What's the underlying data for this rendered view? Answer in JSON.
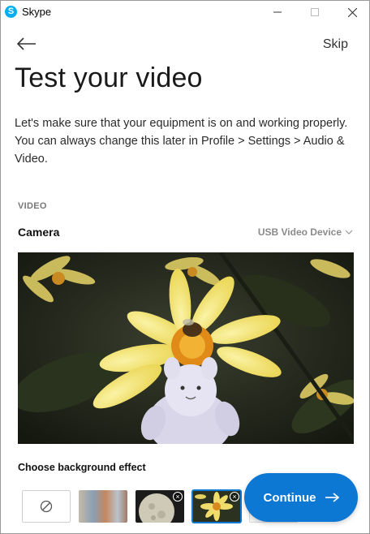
{
  "window": {
    "app_title": "Skype",
    "logo_letter": "S"
  },
  "header": {
    "skip_label": "Skip"
  },
  "page": {
    "title": "Test your video",
    "intro": "Let's make sure that your equipment is on and working properly. You can always change this later in Profile > Settings > Audio & Video."
  },
  "video_section": {
    "label": "VIDEO",
    "camera_label": "Camera",
    "camera_device": "USB Video Device"
  },
  "background_effects": {
    "label": "Choose background effect",
    "items": [
      {
        "name": "none",
        "selected": false
      },
      {
        "name": "blur-office",
        "selected": false
      },
      {
        "name": "moon",
        "selected": false,
        "removable": true
      },
      {
        "name": "flower",
        "selected": true,
        "removable": true
      },
      {
        "name": "more",
        "selected": false
      }
    ]
  },
  "footer": {
    "continue_label": "Continue"
  },
  "colors": {
    "accent": "#0c78d4",
    "skype_blue": "#00aff0"
  },
  "icons": {
    "back": "arrow-left-icon",
    "continue": "arrow-right-icon",
    "dropdown": "chevron-down-icon",
    "none_effect": "no-entry-icon"
  }
}
